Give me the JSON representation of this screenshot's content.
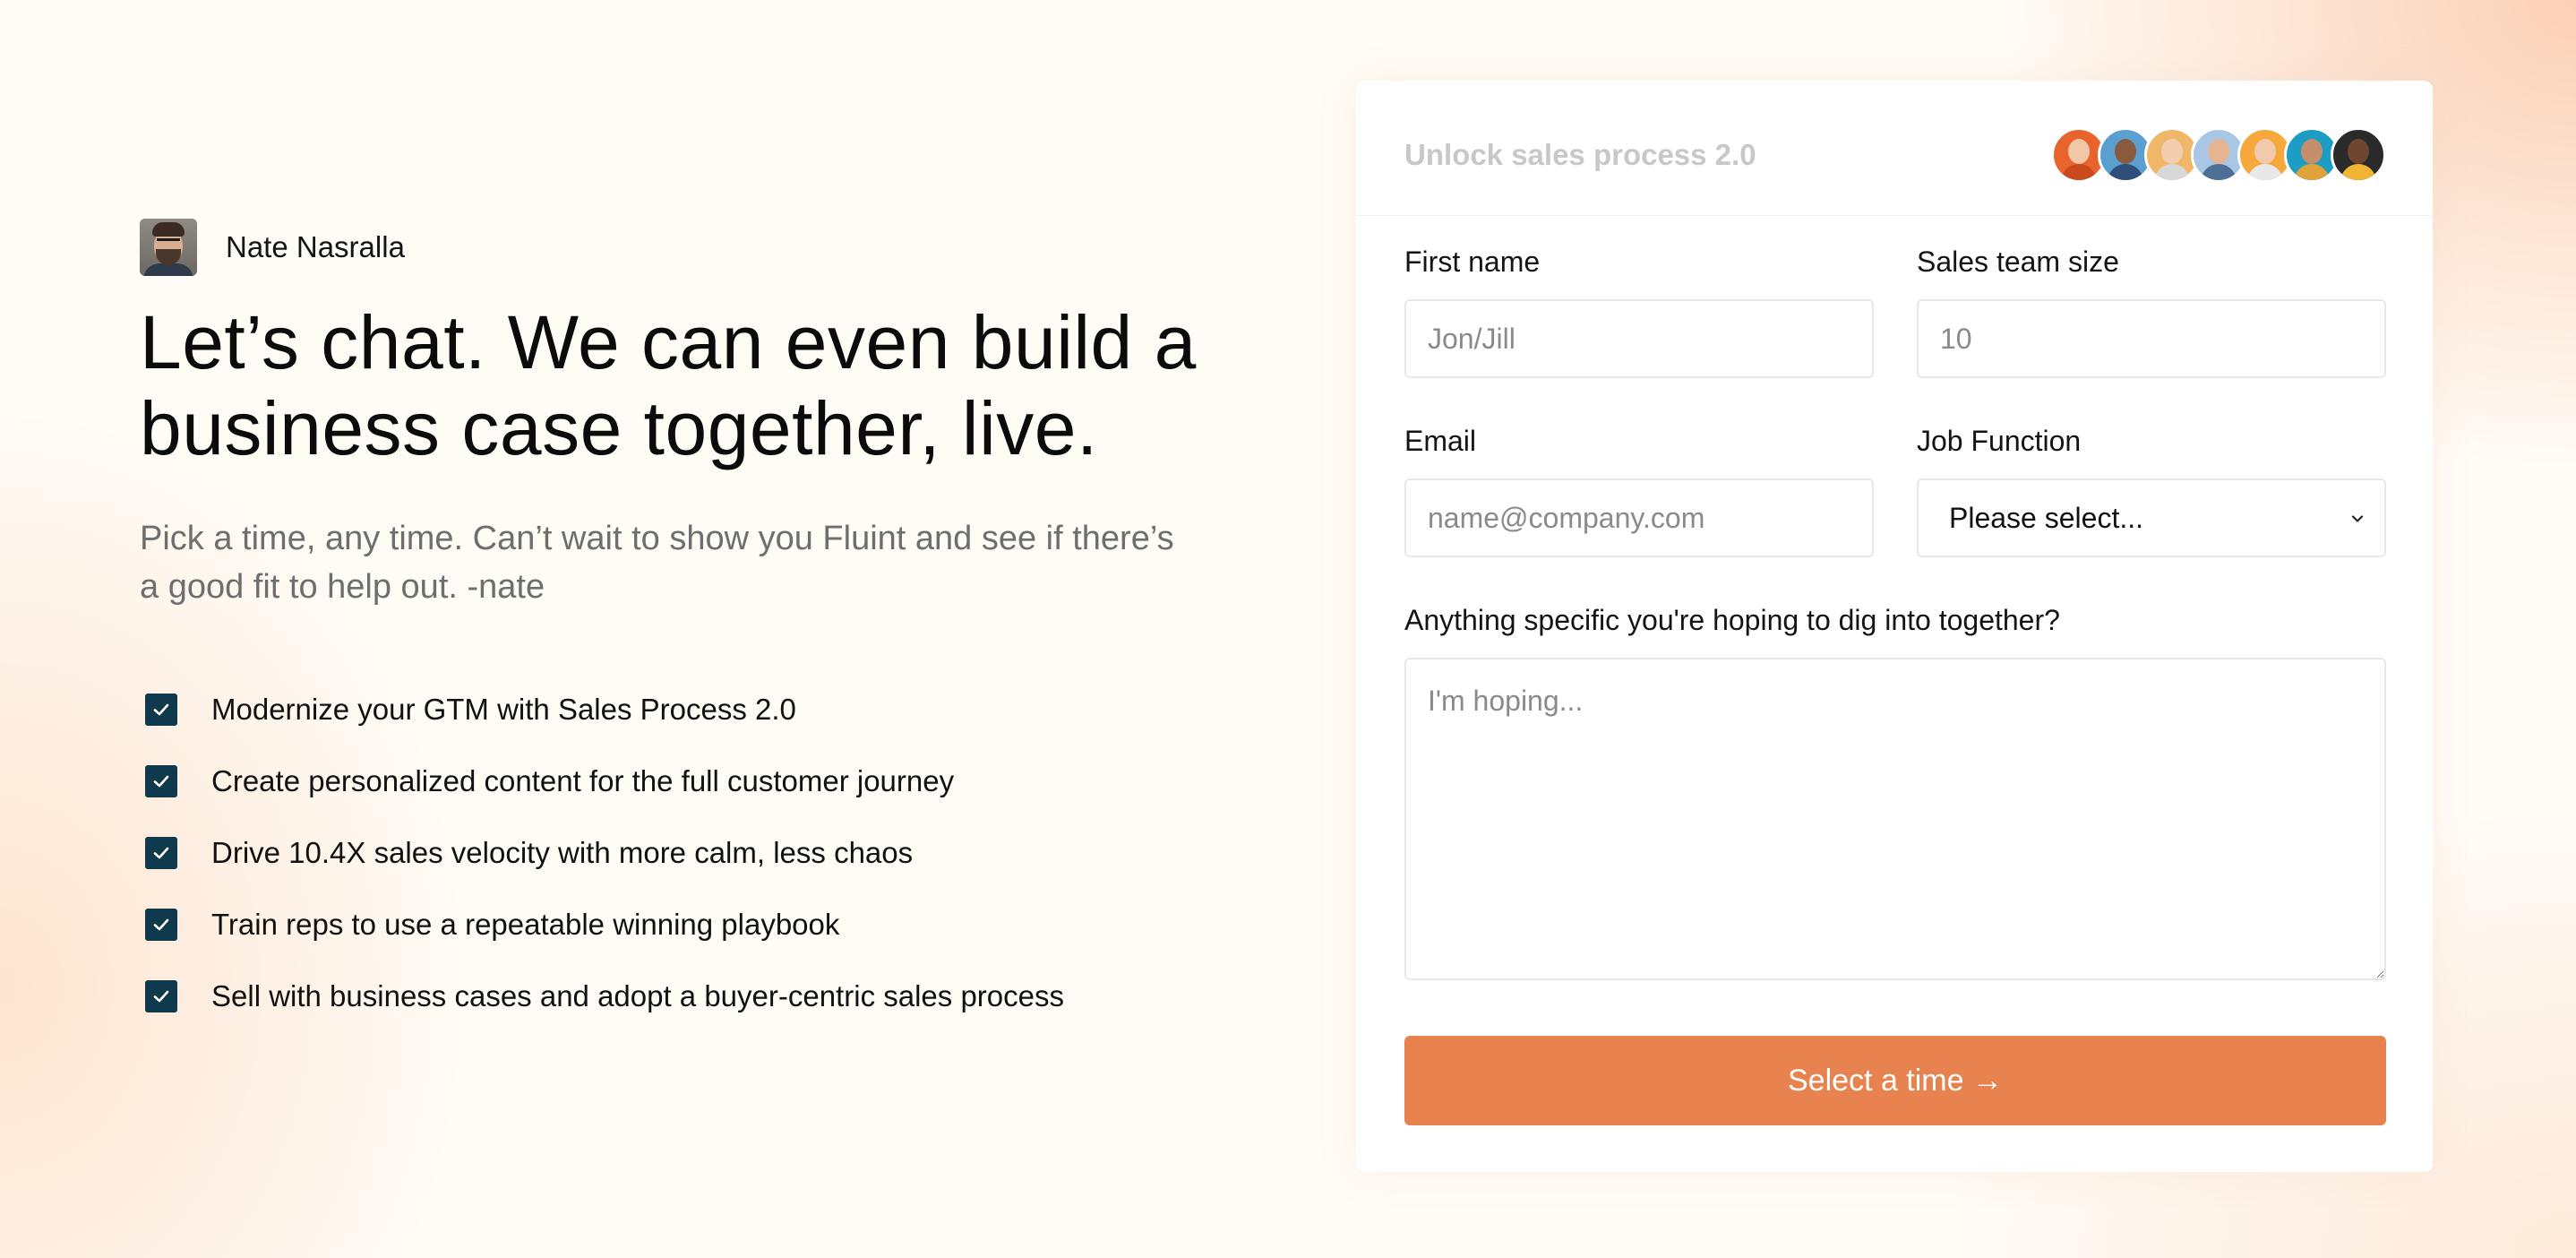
{
  "author": {
    "name": "Nate Nasralla",
    "avatar_icon": "person-avatar"
  },
  "hero": {
    "headline": "Let’s chat. We can even build a business case together, live.",
    "subtext": "Pick a time, any time. Can’t wait to show you Fluint and see if there’s a good fit to help out. -nate"
  },
  "features": [
    "Modernize your GTM with Sales Process 2.0",
    "Create personalized content for the full customer journey",
    "Drive 10.4X sales velocity with more calm, less chaos",
    "Train reps to use a repeatable winning playbook",
    "Sell with business cases and adopt a buyer-centric sales process"
  ],
  "form": {
    "title": "Unlock sales process 2.0",
    "team_avatars": [
      {
        "bg": "#e8642c",
        "skin": "#f1c7a8",
        "body": "#c94a1d"
      },
      {
        "bg": "#5b9fd1",
        "skin": "#8a5a3e",
        "body": "#2f4f7a"
      },
      {
        "bg": "#f0b768",
        "skin": "#f2cdb0",
        "body": "#d8d8d8"
      },
      {
        "bg": "#a9c7e4",
        "skin": "#e3b592",
        "body": "#4d6f95"
      },
      {
        "bg": "#f6a93a",
        "skin": "#f2c9ab",
        "body": "#e8e8e8"
      },
      {
        "bg": "#1d9cc4",
        "skin": "#c58f6c",
        "body": "#e2a23a"
      },
      {
        "bg": "#2a2a2a",
        "skin": "#6f4630",
        "body": "#f2b433"
      }
    ],
    "first_name": {
      "label": "First name",
      "placeholder": "Jon/Jill"
    },
    "team_size": {
      "label": "Sales team size",
      "placeholder": "10"
    },
    "email": {
      "label": "Email",
      "placeholder": "name@company.com"
    },
    "job_function": {
      "label": "Job Function",
      "selected": "Please select..."
    },
    "details": {
      "label": "Anything specific you're hoping to dig into together?",
      "placeholder": "I'm hoping..."
    },
    "submit_label": "Select a time →"
  },
  "colors": {
    "accent": "#e8834f",
    "check": "#0f3a4e",
    "background": "#fffbf5"
  }
}
